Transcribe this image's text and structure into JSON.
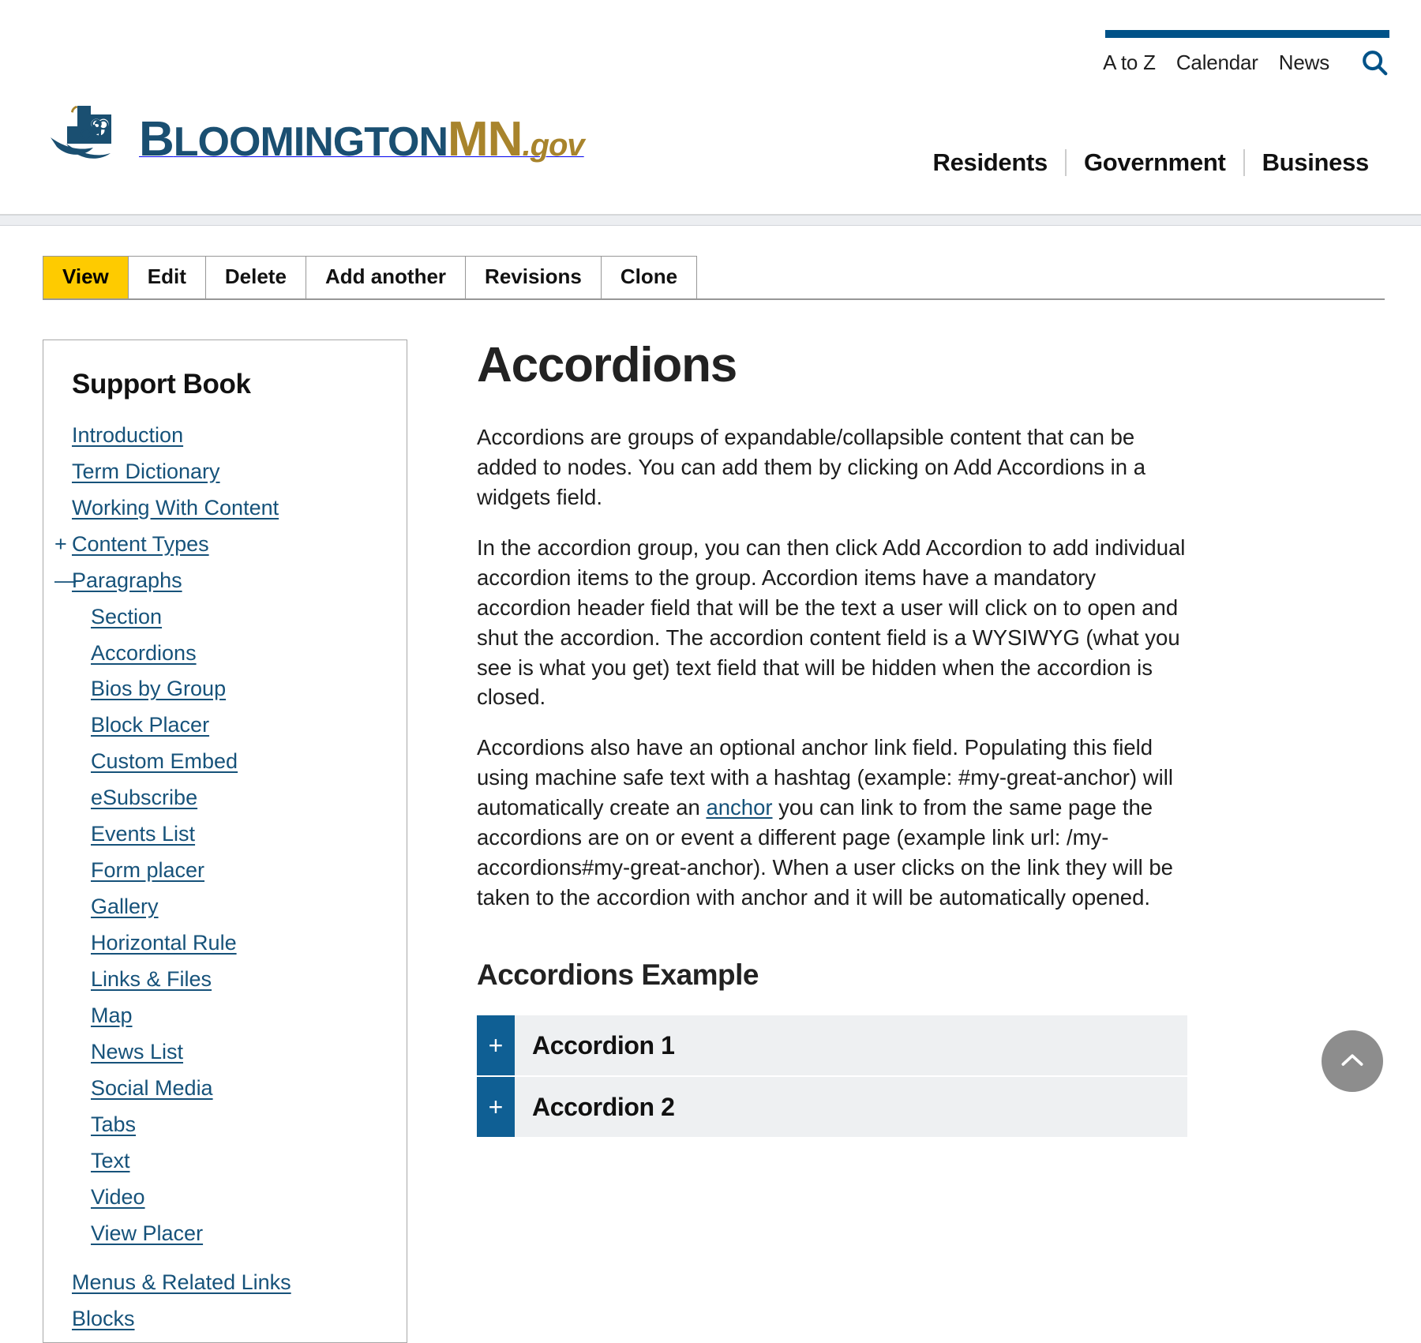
{
  "brand": {
    "logo_text_primary": "B",
    "logo_text_primary_rest": "LOOMINGTON",
    "logo_text_accent": "MN",
    "logo_text_suffix": ".gov",
    "logo_icon": "city-skyline-bird-logo",
    "color_navy": "#1a4f71",
    "color_gold": "#a8842c",
    "color_blue": "#005288"
  },
  "utility_nav": {
    "items": [
      {
        "label": "A to Z"
      },
      {
        "label": "Calendar"
      },
      {
        "label": "News"
      }
    ],
    "search_icon": "search-icon"
  },
  "main_nav": {
    "items": [
      {
        "label": "Residents"
      },
      {
        "label": "Government"
      },
      {
        "label": "Business"
      }
    ]
  },
  "admin_tabs": {
    "active": "View",
    "items": [
      {
        "label": "View",
        "active": true
      },
      {
        "label": "Edit",
        "active": false
      },
      {
        "label": "Delete",
        "active": false
      },
      {
        "label": "Add another",
        "active": false
      },
      {
        "label": "Revisions",
        "active": false
      },
      {
        "label": "Clone",
        "active": false
      }
    ],
    "active_color": "#fecb00"
  },
  "sidebar": {
    "title": "Support Book",
    "items": [
      {
        "label": "Introduction",
        "toggle": "",
        "level": 1
      },
      {
        "label": "Term Dictionary",
        "toggle": "",
        "level": 1
      },
      {
        "label": "Working With Content",
        "toggle": "",
        "level": 1
      },
      {
        "label": "Content Types",
        "toggle": "+",
        "level": 1
      },
      {
        "label": "Paragraphs",
        "toggle": "—",
        "level": 1
      }
    ],
    "paragraph_children": [
      {
        "label": "Section"
      },
      {
        "label": "Accordions"
      },
      {
        "label": "Bios by Group"
      },
      {
        "label": "Block Placer"
      },
      {
        "label": "Custom Embed"
      },
      {
        "label": "eSubscribe"
      },
      {
        "label": "Events List"
      },
      {
        "label": "Form placer"
      },
      {
        "label": "Gallery"
      },
      {
        "label": "Horizontal Rule"
      },
      {
        "label": "Links & Files"
      },
      {
        "label": "Map"
      },
      {
        "label": "News List"
      },
      {
        "label": "Social Media"
      },
      {
        "label": "Tabs"
      },
      {
        "label": "Text"
      },
      {
        "label": "Video"
      },
      {
        "label": "View Placer"
      }
    ],
    "trailing_items": [
      {
        "label": "Menus & Related Links"
      },
      {
        "label": "Blocks"
      }
    ],
    "link_color": "#16527a"
  },
  "main": {
    "title": "Accordions",
    "paragraph_1": "Accordions are groups of expandable/collapsible content that can be added to nodes. You can add them by clicking on Add Accordions in a widgets field.",
    "paragraph_2": "In the accordion group, you can then click Add Accordion to add individual accordion items to the group. Accordion items have a mandatory accordion header field that will be the text a user will click on to open and shut the accordion. The accordion content field is a WYSIWYG (what you see is what you get) text field that will be hidden when the accordion is closed.",
    "paragraph_3_part1": "Accordions also have an optional anchor link field. Populating this field using machine safe text with a hashtag (example: #my-great-anchor) will automatically create an ",
    "paragraph_3_link": "anchor",
    "paragraph_3_part2": " you can link to from the same page the accordions are on or event a different page (example link url: /my-accordions#my-great-anchor). When a user clicks on the link they will be taken to the accordion with anchor and it will be automatically opened.",
    "example_heading": "Accordions Example",
    "accordions": [
      {
        "toggle": "+",
        "label": "Accordion 1"
      },
      {
        "toggle": "+",
        "label": "Accordion 2"
      }
    ],
    "accordion_toggle_color": "#0f5f94",
    "accordion_bg_color": "#eef0f2"
  },
  "back_to_top": {
    "icon": "chevron-up-icon"
  }
}
